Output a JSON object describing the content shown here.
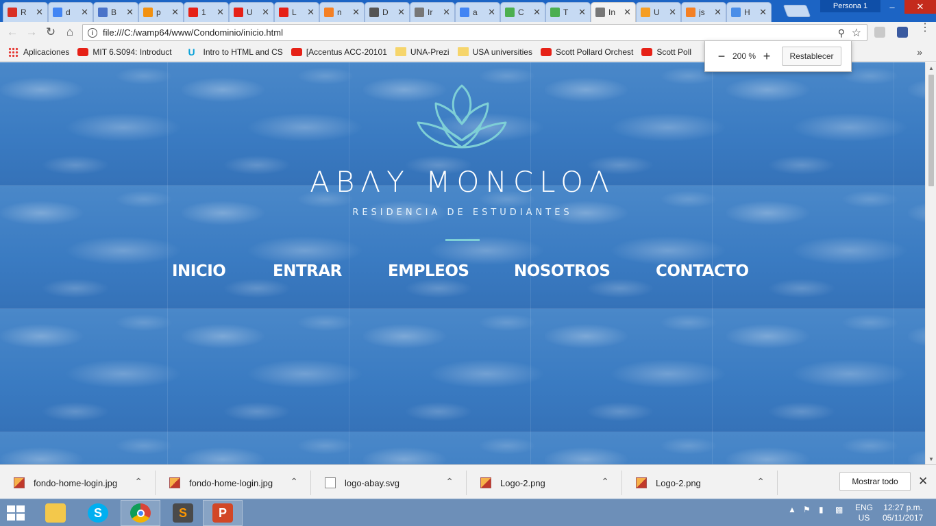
{
  "browser": {
    "profile": "Persona 1",
    "tabs": [
      {
        "label": "R",
        "icon": "gmail-icon",
        "color": "#d93025"
      },
      {
        "label": "d",
        "icon": "google-icon",
        "color": "#4285f4"
      },
      {
        "label": "B",
        "icon": "globe-icon",
        "color": "#4a73c9"
      },
      {
        "label": "p",
        "icon": "phpmyadmin-icon",
        "color": "#f29111"
      },
      {
        "label": "1",
        "icon": "youtube-icon",
        "color": "#e62117"
      },
      {
        "label": "U",
        "icon": "youtube-icon",
        "color": "#e62117"
      },
      {
        "label": "L",
        "icon": "youtube-icon",
        "color": "#e62117"
      },
      {
        "label": "n",
        "icon": "stackoverflow-icon",
        "color": "#f48024"
      },
      {
        "label": "D",
        "icon": "download-icon",
        "color": "#555555"
      },
      {
        "label": "Ir",
        "icon": "page-icon",
        "color": "#777777"
      },
      {
        "label": "a",
        "icon": "google-icon",
        "color": "#4285f4"
      },
      {
        "label": "C",
        "icon": "w3schools-icon",
        "color": "#4caf50"
      },
      {
        "label": "T",
        "icon": "w3schools-icon",
        "color": "#4caf50"
      },
      {
        "label": "In",
        "icon": "page-icon",
        "color": "#777777"
      },
      {
        "label": "U",
        "icon": "asterisk-icon",
        "color": "#f59e24"
      },
      {
        "label": "js",
        "icon": "stackoverflow-icon",
        "color": "#f48024"
      },
      {
        "label": "H",
        "icon": "reload-icon",
        "color": "#4a8ee8"
      }
    ],
    "url": "file:///C:/wamp64/www/Condominio/inicio.html",
    "bookmarks": [
      {
        "label": "Aplicaciones",
        "icon": "apps-icon"
      },
      {
        "label": "MIT 6.S094: Introduct",
        "icon": "youtube-icon"
      },
      {
        "label": "",
        "icon": "page-icon"
      },
      {
        "label": "Intro to HTML and CS",
        "icon": "udacity-icon"
      },
      {
        "label": "[Accentus ACC-20101",
        "icon": "youtube-icon"
      },
      {
        "label": "UNA-Prezi",
        "icon": "folder-icon"
      },
      {
        "label": "USA universities",
        "icon": "folder-icon"
      },
      {
        "label": "Scott Pollard Orchest",
        "icon": "youtube-icon"
      },
      {
        "label": "Scott Poll",
        "icon": "youtube-icon"
      }
    ],
    "zoom": {
      "value": "200 %",
      "minus": "−",
      "plus": "+",
      "reset": "Restablecer"
    }
  },
  "site": {
    "brand": "ABΛY MONCLOΛ",
    "tagline": "RESIDENCIA DE ESTUDIANTES",
    "nav": [
      "INICIO",
      "ENTRAR",
      "EMPLEOS",
      "NOSOTROS",
      "CONTACTO"
    ],
    "accent": "#7ecfd6"
  },
  "downloads": {
    "items": [
      {
        "name": "fondo-home-login.jpg",
        "type": "jpg"
      },
      {
        "name": "fondo-home-login.jpg",
        "type": "jpg"
      },
      {
        "name": "logo-abay.svg",
        "type": "svg"
      },
      {
        "name": "Logo-2.png",
        "type": "png"
      },
      {
        "name": "Logo-2.png",
        "type": "png"
      }
    ],
    "show_all": "Mostrar todo"
  },
  "taskbar": {
    "apps": [
      "file-explorer-icon",
      "skype-icon",
      "chrome-icon",
      "sublime-text-icon",
      "powerpoint-icon"
    ],
    "language": [
      "ENG",
      "US"
    ],
    "time": "12:27 p.m.",
    "date": "05/11/2017"
  }
}
